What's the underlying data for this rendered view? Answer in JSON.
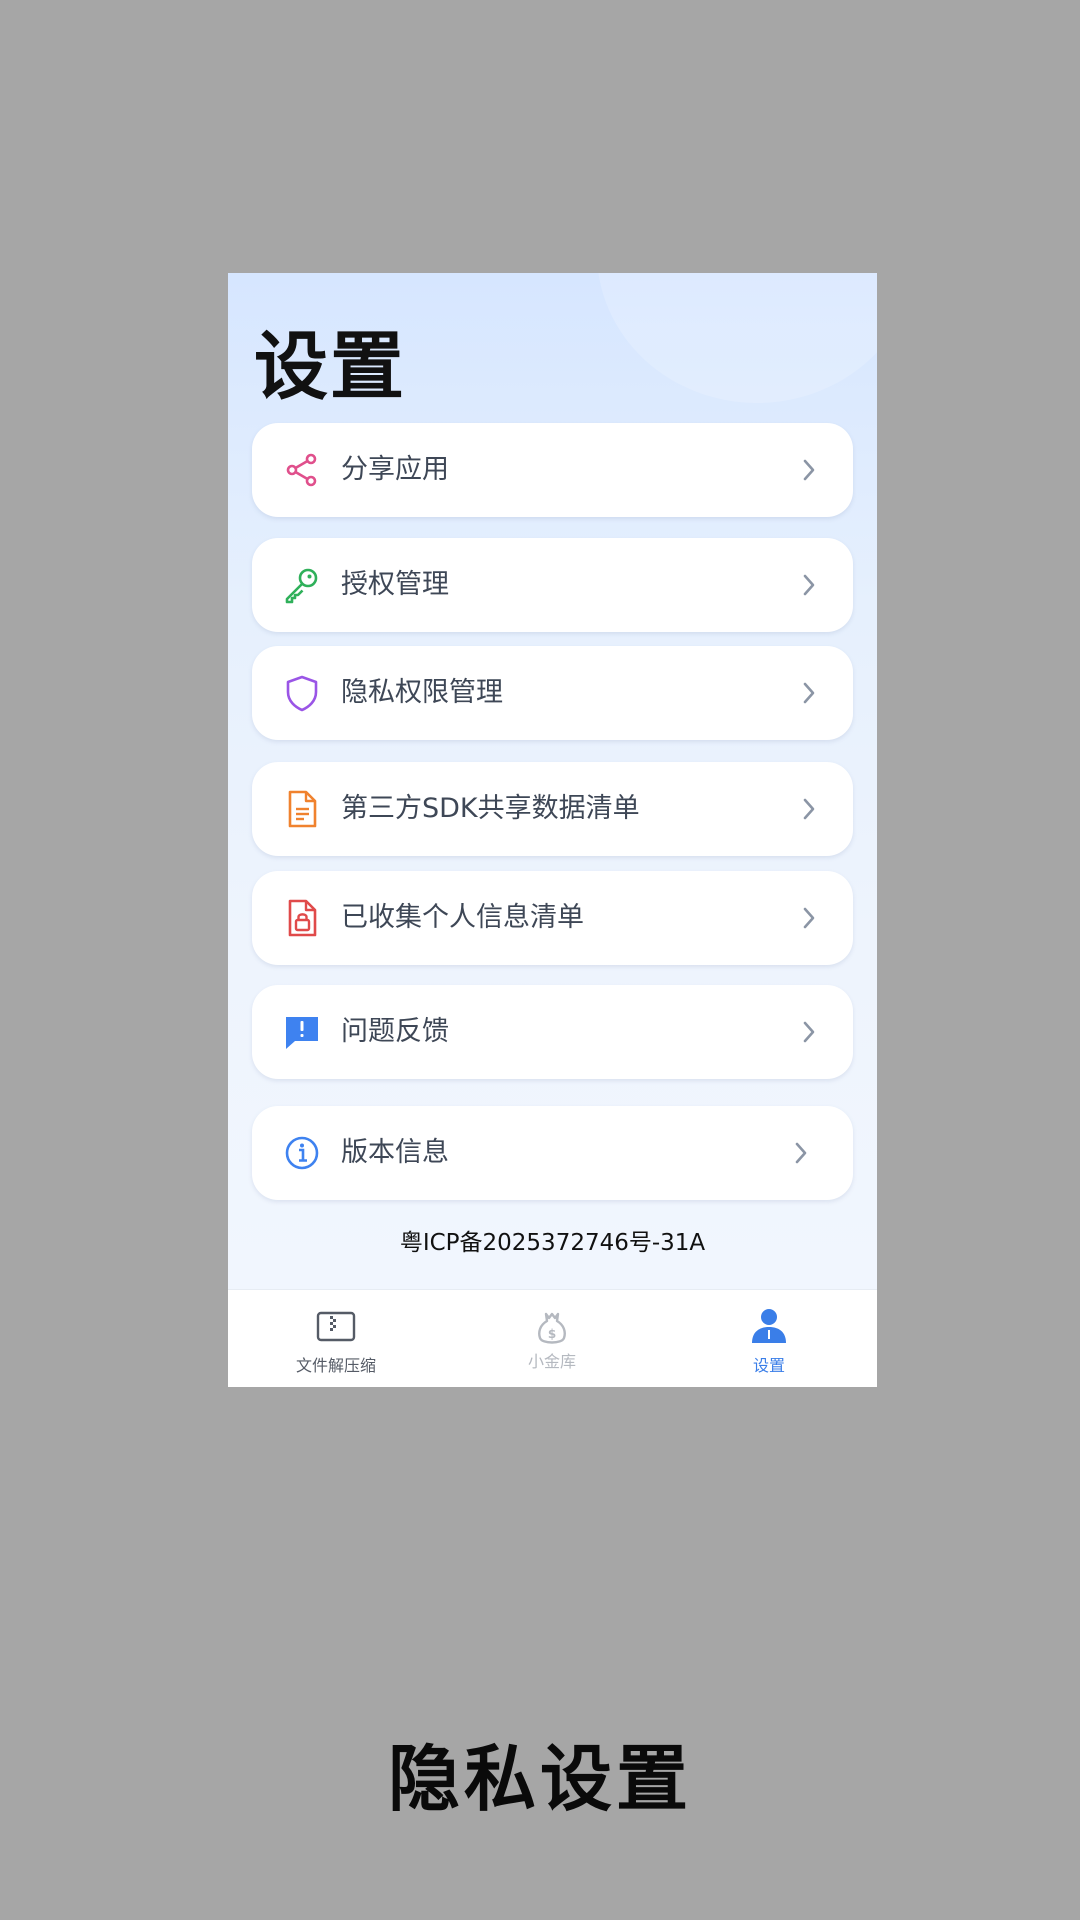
{
  "page_title": "设置",
  "menu": [
    {
      "label": "分享应用",
      "icon": "share-icon",
      "color": "#e0508c"
    },
    {
      "label": "授权管理",
      "icon": "key-icon",
      "color": "#2fb05a"
    },
    {
      "label": "隐私权限管理",
      "icon": "shield-icon",
      "color": "#9a55e6"
    },
    {
      "label": "第三方SDK共享数据清单",
      "icon": "document-icon",
      "color": "#f0822e"
    },
    {
      "label": "已收集个人信息清单",
      "icon": "lock-document-icon",
      "color": "#e04a4a"
    },
    {
      "label": "问题反馈",
      "icon": "feedback-icon",
      "color": "#3e82f0"
    },
    {
      "label": "版本信息",
      "icon": "info-icon",
      "color": "#3e82f0"
    }
  ],
  "footer": {
    "icp": "粤ICP备2025372746号-31A"
  },
  "tabs": [
    {
      "label": "文件解压缩",
      "icon": "archive-icon",
      "active": false,
      "color": "#555b66"
    },
    {
      "label": "小金库",
      "icon": "money-bag-icon",
      "active": false,
      "color": "#b5b9c0"
    },
    {
      "label": "设置",
      "icon": "person-icon",
      "active": true,
      "color": "#3a7ee8"
    }
  ],
  "caption": "隐私设置"
}
